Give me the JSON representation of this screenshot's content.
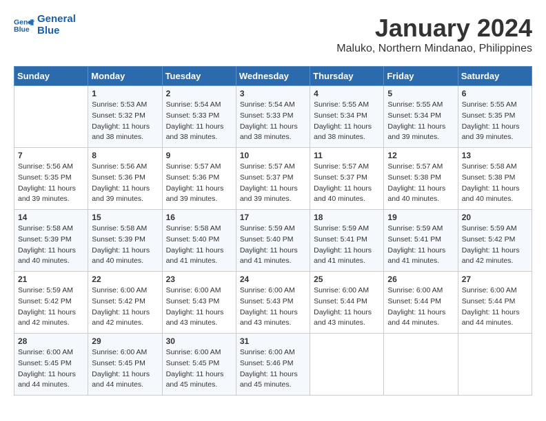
{
  "header": {
    "logo_line1": "General",
    "logo_line2": "Blue",
    "month": "January 2024",
    "location": "Maluko, Northern Mindanao, Philippines"
  },
  "weekdays": [
    "Sunday",
    "Monday",
    "Tuesday",
    "Wednesday",
    "Thursday",
    "Friday",
    "Saturday"
  ],
  "weeks": [
    [
      {
        "day": "",
        "info": ""
      },
      {
        "day": "1",
        "info": "Sunrise: 5:53 AM\nSunset: 5:32 PM\nDaylight: 11 hours\nand 38 minutes."
      },
      {
        "day": "2",
        "info": "Sunrise: 5:54 AM\nSunset: 5:33 PM\nDaylight: 11 hours\nand 38 minutes."
      },
      {
        "day": "3",
        "info": "Sunrise: 5:54 AM\nSunset: 5:33 PM\nDaylight: 11 hours\nand 38 minutes."
      },
      {
        "day": "4",
        "info": "Sunrise: 5:55 AM\nSunset: 5:34 PM\nDaylight: 11 hours\nand 38 minutes."
      },
      {
        "day": "5",
        "info": "Sunrise: 5:55 AM\nSunset: 5:34 PM\nDaylight: 11 hours\nand 39 minutes."
      },
      {
        "day": "6",
        "info": "Sunrise: 5:55 AM\nSunset: 5:35 PM\nDaylight: 11 hours\nand 39 minutes."
      }
    ],
    [
      {
        "day": "7",
        "info": "Sunrise: 5:56 AM\nSunset: 5:35 PM\nDaylight: 11 hours\nand 39 minutes."
      },
      {
        "day": "8",
        "info": "Sunrise: 5:56 AM\nSunset: 5:36 PM\nDaylight: 11 hours\nand 39 minutes."
      },
      {
        "day": "9",
        "info": "Sunrise: 5:57 AM\nSunset: 5:36 PM\nDaylight: 11 hours\nand 39 minutes."
      },
      {
        "day": "10",
        "info": "Sunrise: 5:57 AM\nSunset: 5:37 PM\nDaylight: 11 hours\nand 39 minutes."
      },
      {
        "day": "11",
        "info": "Sunrise: 5:57 AM\nSunset: 5:37 PM\nDaylight: 11 hours\nand 40 minutes."
      },
      {
        "day": "12",
        "info": "Sunrise: 5:57 AM\nSunset: 5:38 PM\nDaylight: 11 hours\nand 40 minutes."
      },
      {
        "day": "13",
        "info": "Sunrise: 5:58 AM\nSunset: 5:38 PM\nDaylight: 11 hours\nand 40 minutes."
      }
    ],
    [
      {
        "day": "14",
        "info": "Sunrise: 5:58 AM\nSunset: 5:39 PM\nDaylight: 11 hours\nand 40 minutes."
      },
      {
        "day": "15",
        "info": "Sunrise: 5:58 AM\nSunset: 5:39 PM\nDaylight: 11 hours\nand 40 minutes."
      },
      {
        "day": "16",
        "info": "Sunrise: 5:58 AM\nSunset: 5:40 PM\nDaylight: 11 hours\nand 41 minutes."
      },
      {
        "day": "17",
        "info": "Sunrise: 5:59 AM\nSunset: 5:40 PM\nDaylight: 11 hours\nand 41 minutes."
      },
      {
        "day": "18",
        "info": "Sunrise: 5:59 AM\nSunset: 5:41 PM\nDaylight: 11 hours\nand 41 minutes."
      },
      {
        "day": "19",
        "info": "Sunrise: 5:59 AM\nSunset: 5:41 PM\nDaylight: 11 hours\nand 41 minutes."
      },
      {
        "day": "20",
        "info": "Sunrise: 5:59 AM\nSunset: 5:42 PM\nDaylight: 11 hours\nand 42 minutes."
      }
    ],
    [
      {
        "day": "21",
        "info": "Sunrise: 5:59 AM\nSunset: 5:42 PM\nDaylight: 11 hours\nand 42 minutes."
      },
      {
        "day": "22",
        "info": "Sunrise: 6:00 AM\nSunset: 5:42 PM\nDaylight: 11 hours\nand 42 minutes."
      },
      {
        "day": "23",
        "info": "Sunrise: 6:00 AM\nSunset: 5:43 PM\nDaylight: 11 hours\nand 43 minutes."
      },
      {
        "day": "24",
        "info": "Sunrise: 6:00 AM\nSunset: 5:43 PM\nDaylight: 11 hours\nand 43 minutes."
      },
      {
        "day": "25",
        "info": "Sunrise: 6:00 AM\nSunset: 5:44 PM\nDaylight: 11 hours\nand 43 minutes."
      },
      {
        "day": "26",
        "info": "Sunrise: 6:00 AM\nSunset: 5:44 PM\nDaylight: 11 hours\nand 44 minutes."
      },
      {
        "day": "27",
        "info": "Sunrise: 6:00 AM\nSunset: 5:44 PM\nDaylight: 11 hours\nand 44 minutes."
      }
    ],
    [
      {
        "day": "28",
        "info": "Sunrise: 6:00 AM\nSunset: 5:45 PM\nDaylight: 11 hours\nand 44 minutes."
      },
      {
        "day": "29",
        "info": "Sunrise: 6:00 AM\nSunset: 5:45 PM\nDaylight: 11 hours\nand 44 minutes."
      },
      {
        "day": "30",
        "info": "Sunrise: 6:00 AM\nSunset: 5:45 PM\nDaylight: 11 hours\nand 45 minutes."
      },
      {
        "day": "31",
        "info": "Sunrise: 6:00 AM\nSunset: 5:46 PM\nDaylight: 11 hours\nand 45 minutes."
      },
      {
        "day": "",
        "info": ""
      },
      {
        "day": "",
        "info": ""
      },
      {
        "day": "",
        "info": ""
      }
    ]
  ]
}
